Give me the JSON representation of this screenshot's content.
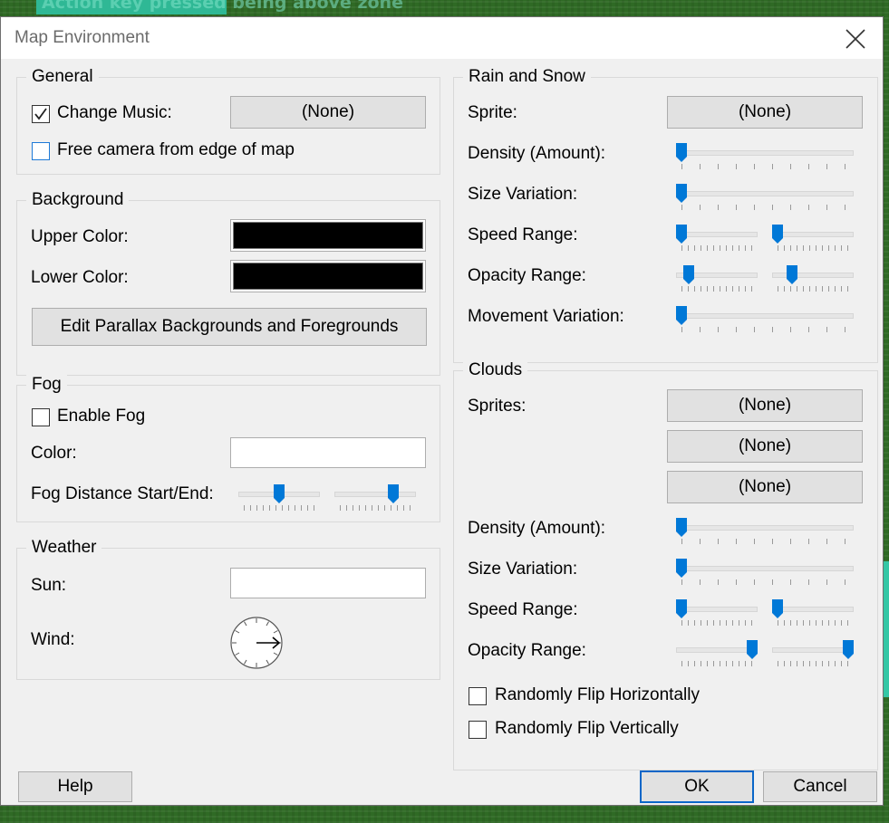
{
  "background": {
    "banner_text": "Action key pressed being above zone"
  },
  "window": {
    "title": "Map Environment",
    "close_label": "close"
  },
  "general": {
    "title": "General",
    "change_music": {
      "label": "Change Music:",
      "checked": true
    },
    "music_button": "(None)",
    "free_camera": {
      "label": "Free camera from edge of map",
      "checked": false
    }
  },
  "background_group": {
    "title": "Background",
    "upper_label": "Upper Color:",
    "upper_color": "#000000",
    "lower_label": "Lower Color:",
    "lower_color": "#000000",
    "parallax_button": "Edit Parallax Backgrounds and Foregrounds"
  },
  "fog": {
    "title": "Fog",
    "enable": {
      "label": "Enable Fog",
      "checked": false
    },
    "color_label": "Color:",
    "color": "#ffffff",
    "distance_label": "Fog Distance Start/End:",
    "start": 0.5,
    "end": 0.75
  },
  "weather": {
    "title": "Weather",
    "sun_label": "Sun:",
    "sun_value": "",
    "wind_label": "Wind:",
    "wind_direction": "east"
  },
  "rain_snow": {
    "title": "Rain and Snow",
    "sprite_label": "Sprite:",
    "sprite_button": "(None)",
    "density_label": "Density (Amount):",
    "density": 0,
    "size_label": "Size Variation:",
    "size": 0,
    "speed_label": "Speed Range:",
    "speed_min": 0,
    "speed_max": 0,
    "opacity_label": "Opacity Range:",
    "opacity_min": 0.1,
    "opacity_max": 0.2,
    "movement_label": "Movement Variation:",
    "movement": 0
  },
  "clouds": {
    "title": "Clouds",
    "sprites_label": "Sprites:",
    "sprite_buttons": [
      "(None)",
      "(None)",
      "(None)"
    ],
    "density_label": "Density (Amount):",
    "density": 0,
    "size_label": "Size Variation:",
    "size": 0,
    "speed_label": "Speed Range:",
    "speed_min": 0,
    "speed_max": 0,
    "opacity_label": "Opacity Range:",
    "opacity_min": 1,
    "opacity_max": 1,
    "flip_h": {
      "label": "Randomly Flip Horizontally",
      "checked": false
    },
    "flip_v": {
      "label": "Randomly Flip Vertically",
      "checked": false
    }
  },
  "footer": {
    "help": "Help",
    "ok": "OK",
    "cancel": "Cancel"
  },
  "colors": {
    "accent": "#0078d7",
    "dialog_bg": "#f0f0f0",
    "button_bg": "#e1e1e1"
  }
}
